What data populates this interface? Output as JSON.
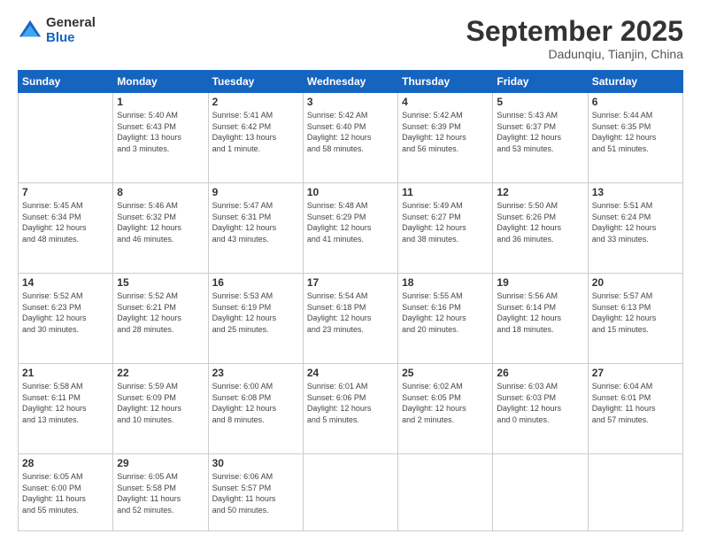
{
  "logo": {
    "general": "General",
    "blue": "Blue"
  },
  "header": {
    "month": "September 2025",
    "location": "Dadunqiu, Tianjin, China"
  },
  "weekdays": [
    "Sunday",
    "Monday",
    "Tuesday",
    "Wednesday",
    "Thursday",
    "Friday",
    "Saturday"
  ],
  "weeks": [
    [
      {
        "day": "",
        "info": ""
      },
      {
        "day": "1",
        "info": "Sunrise: 5:40 AM\nSunset: 6:43 PM\nDaylight: 13 hours\nand 3 minutes."
      },
      {
        "day": "2",
        "info": "Sunrise: 5:41 AM\nSunset: 6:42 PM\nDaylight: 13 hours\nand 1 minute."
      },
      {
        "day": "3",
        "info": "Sunrise: 5:42 AM\nSunset: 6:40 PM\nDaylight: 12 hours\nand 58 minutes."
      },
      {
        "day": "4",
        "info": "Sunrise: 5:42 AM\nSunset: 6:39 PM\nDaylight: 12 hours\nand 56 minutes."
      },
      {
        "day": "5",
        "info": "Sunrise: 5:43 AM\nSunset: 6:37 PM\nDaylight: 12 hours\nand 53 minutes."
      },
      {
        "day": "6",
        "info": "Sunrise: 5:44 AM\nSunset: 6:35 PM\nDaylight: 12 hours\nand 51 minutes."
      }
    ],
    [
      {
        "day": "7",
        "info": "Sunrise: 5:45 AM\nSunset: 6:34 PM\nDaylight: 12 hours\nand 48 minutes."
      },
      {
        "day": "8",
        "info": "Sunrise: 5:46 AM\nSunset: 6:32 PM\nDaylight: 12 hours\nand 46 minutes."
      },
      {
        "day": "9",
        "info": "Sunrise: 5:47 AM\nSunset: 6:31 PM\nDaylight: 12 hours\nand 43 minutes."
      },
      {
        "day": "10",
        "info": "Sunrise: 5:48 AM\nSunset: 6:29 PM\nDaylight: 12 hours\nand 41 minutes."
      },
      {
        "day": "11",
        "info": "Sunrise: 5:49 AM\nSunset: 6:27 PM\nDaylight: 12 hours\nand 38 minutes."
      },
      {
        "day": "12",
        "info": "Sunrise: 5:50 AM\nSunset: 6:26 PM\nDaylight: 12 hours\nand 36 minutes."
      },
      {
        "day": "13",
        "info": "Sunrise: 5:51 AM\nSunset: 6:24 PM\nDaylight: 12 hours\nand 33 minutes."
      }
    ],
    [
      {
        "day": "14",
        "info": "Sunrise: 5:52 AM\nSunset: 6:23 PM\nDaylight: 12 hours\nand 30 minutes."
      },
      {
        "day": "15",
        "info": "Sunrise: 5:52 AM\nSunset: 6:21 PM\nDaylight: 12 hours\nand 28 minutes."
      },
      {
        "day": "16",
        "info": "Sunrise: 5:53 AM\nSunset: 6:19 PM\nDaylight: 12 hours\nand 25 minutes."
      },
      {
        "day": "17",
        "info": "Sunrise: 5:54 AM\nSunset: 6:18 PM\nDaylight: 12 hours\nand 23 minutes."
      },
      {
        "day": "18",
        "info": "Sunrise: 5:55 AM\nSunset: 6:16 PM\nDaylight: 12 hours\nand 20 minutes."
      },
      {
        "day": "19",
        "info": "Sunrise: 5:56 AM\nSunset: 6:14 PM\nDaylight: 12 hours\nand 18 minutes."
      },
      {
        "day": "20",
        "info": "Sunrise: 5:57 AM\nSunset: 6:13 PM\nDaylight: 12 hours\nand 15 minutes."
      }
    ],
    [
      {
        "day": "21",
        "info": "Sunrise: 5:58 AM\nSunset: 6:11 PM\nDaylight: 12 hours\nand 13 minutes."
      },
      {
        "day": "22",
        "info": "Sunrise: 5:59 AM\nSunset: 6:09 PM\nDaylight: 12 hours\nand 10 minutes."
      },
      {
        "day": "23",
        "info": "Sunrise: 6:00 AM\nSunset: 6:08 PM\nDaylight: 12 hours\nand 8 minutes."
      },
      {
        "day": "24",
        "info": "Sunrise: 6:01 AM\nSunset: 6:06 PM\nDaylight: 12 hours\nand 5 minutes."
      },
      {
        "day": "25",
        "info": "Sunrise: 6:02 AM\nSunset: 6:05 PM\nDaylight: 12 hours\nand 2 minutes."
      },
      {
        "day": "26",
        "info": "Sunrise: 6:03 AM\nSunset: 6:03 PM\nDaylight: 12 hours\nand 0 minutes."
      },
      {
        "day": "27",
        "info": "Sunrise: 6:04 AM\nSunset: 6:01 PM\nDaylight: 11 hours\nand 57 minutes."
      }
    ],
    [
      {
        "day": "28",
        "info": "Sunrise: 6:05 AM\nSunset: 6:00 PM\nDaylight: 11 hours\nand 55 minutes."
      },
      {
        "day": "29",
        "info": "Sunrise: 6:05 AM\nSunset: 5:58 PM\nDaylight: 11 hours\nand 52 minutes."
      },
      {
        "day": "30",
        "info": "Sunrise: 6:06 AM\nSunset: 5:57 PM\nDaylight: 11 hours\nand 50 minutes."
      },
      {
        "day": "",
        "info": ""
      },
      {
        "day": "",
        "info": ""
      },
      {
        "day": "",
        "info": ""
      },
      {
        "day": "",
        "info": ""
      }
    ]
  ]
}
